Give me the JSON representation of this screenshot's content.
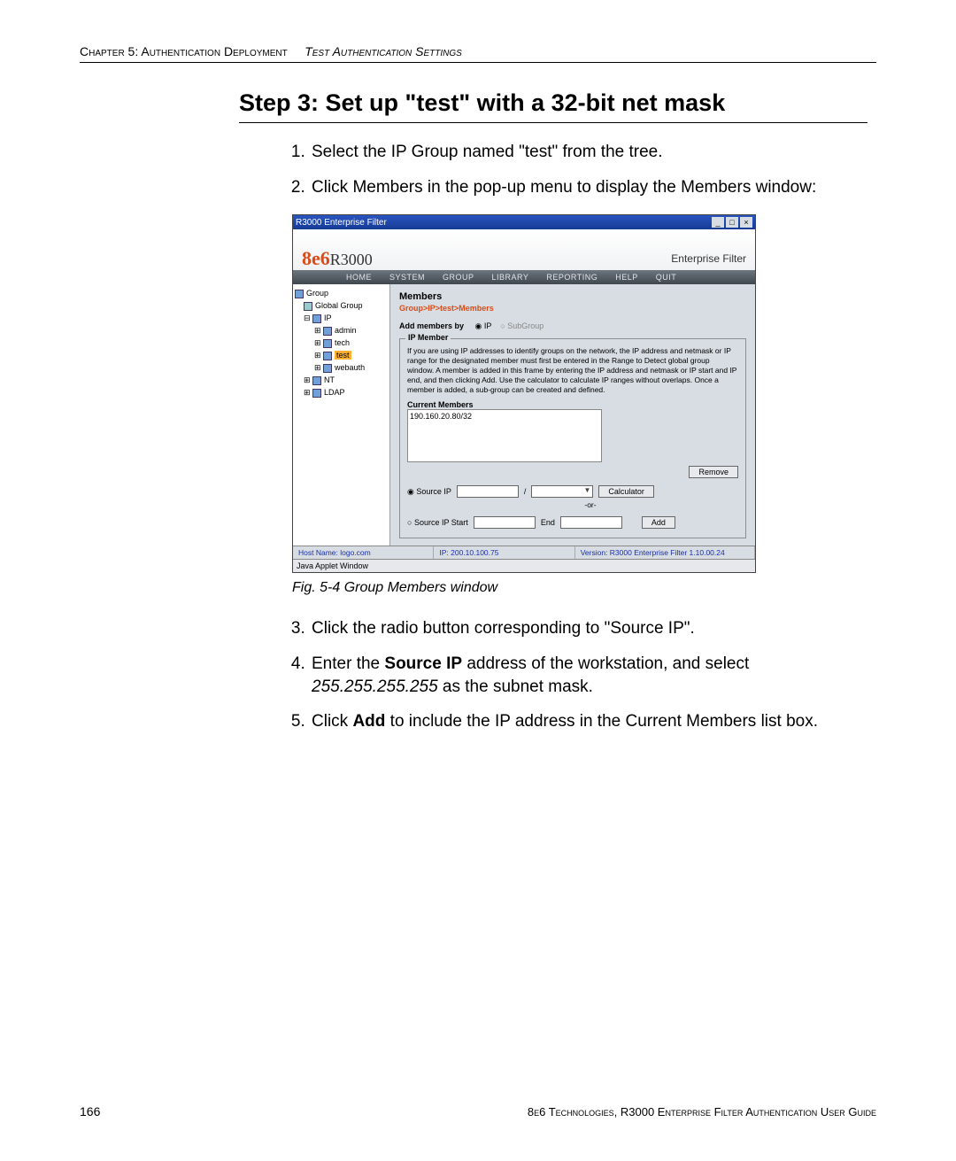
{
  "header": {
    "chapter": "Chapter 5: Authentication Deployment",
    "section": "Test Authentication Settings"
  },
  "title": "Step 3: Set up \"test\" with a 32-bit net mask",
  "steps": {
    "s1": "Select the IP Group named \"test\" from the tree.",
    "s2": "Click Members in the pop-up menu to display the Members window:",
    "s3": "Click the radio button corresponding to \"Source IP\".",
    "s4_a": "Enter the ",
    "s4_b": "Source IP",
    "s4_c": " address of the workstation, and select ",
    "s4_d": "255.255.255.255",
    "s4_e": " as the subnet mask.",
    "s5_a": "Click ",
    "s5_b": "Add",
    "s5_c": " to include the IP address in the Current Members list box."
  },
  "app": {
    "title": "R3000 Enterprise Filter",
    "brand_prefix": "8e6",
    "brand_suffix": "R3000",
    "brand_right": "Enterprise Filter",
    "menu": {
      "home": "HOME",
      "system": "SYSTEM",
      "group": "GROUP",
      "library": "LIBRARY",
      "reporting": "REPORTING",
      "help": "HELP",
      "quit": "QUIT"
    },
    "tree": {
      "root": "Group",
      "n1": "Global Group",
      "n2": "IP",
      "n3": "admin",
      "n4": "tech",
      "n5": "test",
      "n6": "webauth",
      "n7": "NT",
      "n8": "LDAP"
    },
    "main": {
      "heading": "Members",
      "breadcrumb": "Group>IP>test>Members",
      "addby_label": "Add members by",
      "addby_ip": "IP",
      "addby_sub": "SubGroup",
      "ipmember_legend": "IP Member",
      "ipmember_desc": "If you are using IP addresses to identify groups on the network, the IP address and netmask or IP range for the designated member must first be entered in the Range to Detect global group window. A member is added in this frame by entering the IP address and netmask or IP start and IP end, and then clicking Add. Use the calculator to calculate IP ranges without overlaps. Once a member is added, a sub-group can be created and defined.",
      "current_members": "Current Members",
      "member_entry": "190.160.20.80/32",
      "remove_btn": "Remove",
      "src_ip": "Source IP",
      "slash": "/",
      "calc_btn": "Calculator",
      "or": "-or-",
      "src_ip_start": "Source IP Start",
      "end": "End",
      "add_btn": "Add"
    },
    "status": {
      "host": "Host Name: logo.com",
      "ip": "IP: 200.10.100.75",
      "ver": "Version: R3000 Enterprise Filter 1.10.00.24"
    },
    "jaw": "Java Applet Window"
  },
  "figure_caption": "Fig. 5-4  Group Members window",
  "footer": {
    "page": "166",
    "line": "8e6 Technologies, R3000 Enterprise Filter Authentication User Guide"
  }
}
